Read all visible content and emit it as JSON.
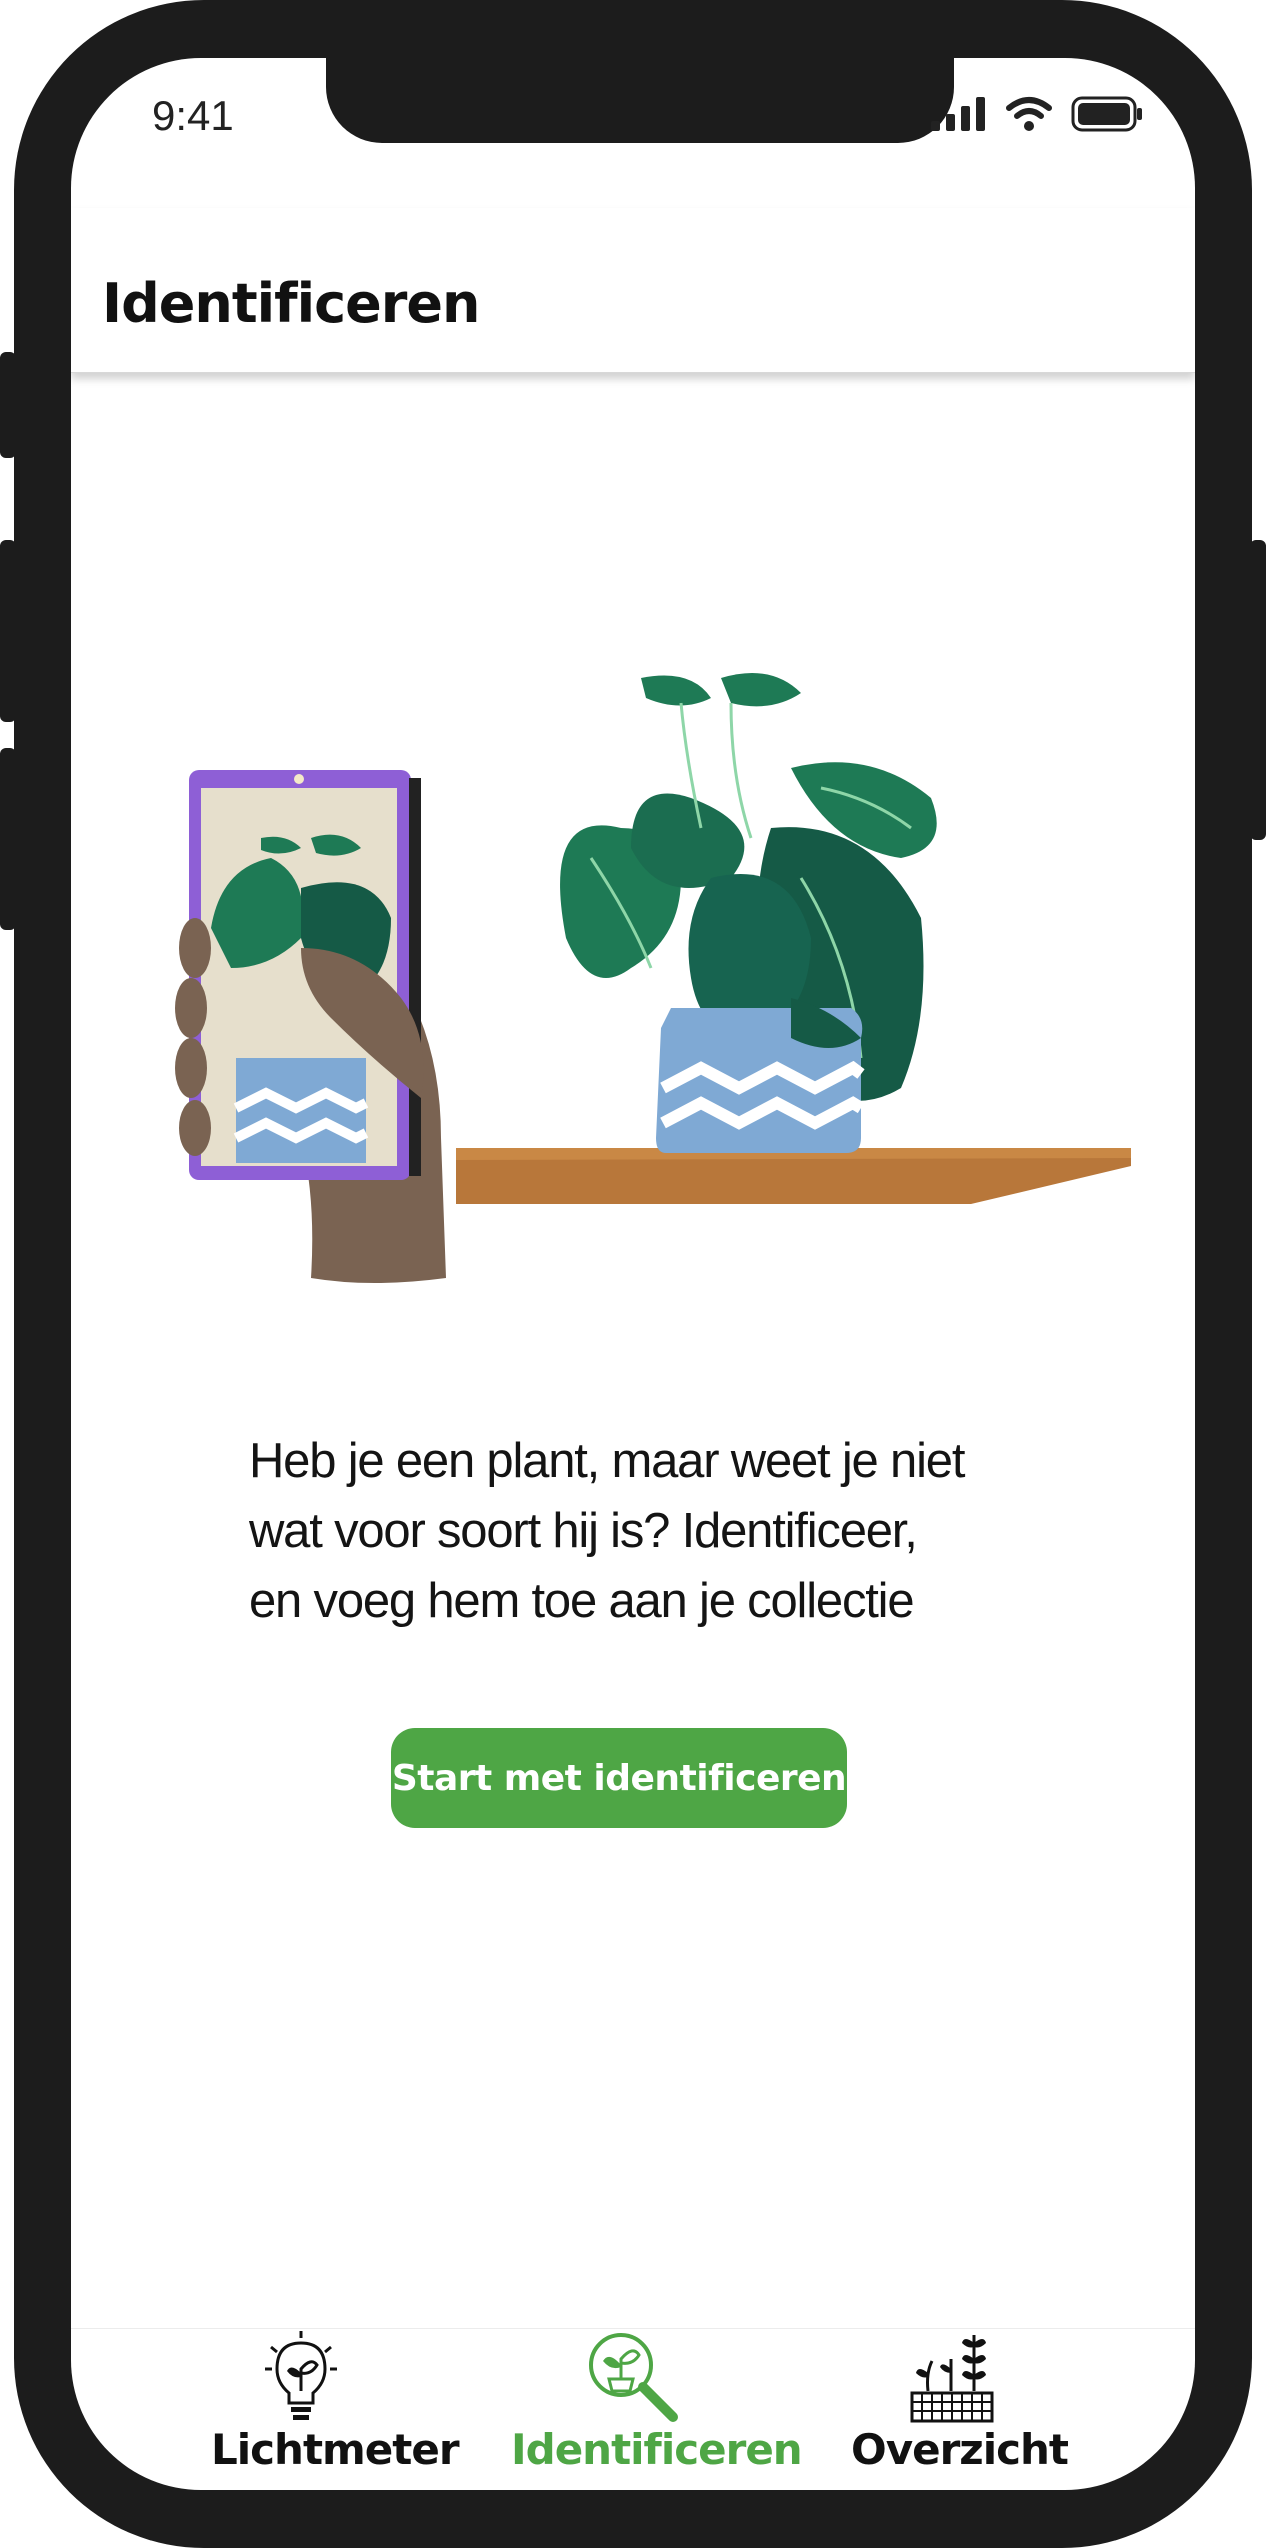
{
  "status_bar": {
    "time": "9:41"
  },
  "app_bar": {
    "title": "Identificeren"
  },
  "main": {
    "description_lines": [
      "Heb je een plant, maar weet je niet",
      "wat voor soort hij is? Identificeer,",
      "en voeg hem toe aan je collectie"
    ],
    "cta_label": "Start met identificeren"
  },
  "bottom_nav": {
    "items": [
      {
        "label": "Lichtmeter",
        "icon": "lightbulb-plant-icon",
        "active": false
      },
      {
        "label": "Identificeren",
        "icon": "plant-magnifier-icon",
        "active": true
      },
      {
        "label": "Overzicht",
        "icon": "plants-grid-icon",
        "active": false
      }
    ]
  },
  "colors": {
    "accent": "#4ea645",
    "frame": "#1c1c1c",
    "leaf_dark": "#1b5e4a",
    "leaf_mid": "#1e7a55",
    "pot": "#7fa9d4",
    "shelf": "#b8773a",
    "hand": "#7a6352",
    "phone_case": "#8e5fd6"
  }
}
